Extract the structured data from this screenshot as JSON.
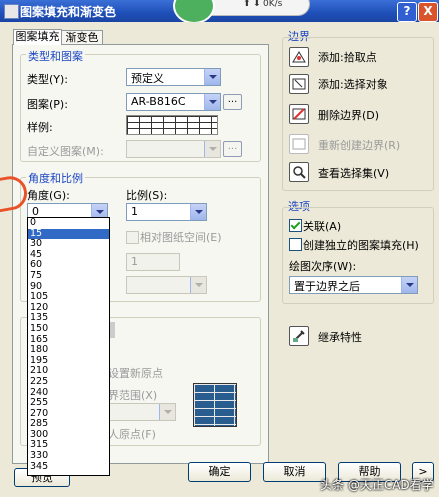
{
  "window": {
    "title": "图案填充和渐变色",
    "help_label": "?",
    "close_label": "X"
  },
  "network": {
    "upload_arrow": "⬆",
    "download_arrow": "⬇",
    "speed": "0K/s"
  },
  "tabs": [
    {
      "label": "图案填充"
    },
    {
      "label": "渐变色"
    }
  ],
  "type_pattern": {
    "title": "类型和图案",
    "type_label": "类型(Y):",
    "type_value": "预定义",
    "pattern_label": "图案(P):",
    "pattern_value": "AR-B816C",
    "pattern_more": "...",
    "sample_label": "样例:",
    "custom_label": "自定义图案(M):",
    "custom_more": "..."
  },
  "angle_scale": {
    "title": "角度和比例",
    "angle_label": "角度(G):",
    "angle_value": "0",
    "scale_label": "比例(S):",
    "scale_value": "1",
    "relative_label": "相对图纸空间(E)",
    "spacing_value": "1",
    "list_options": [
      "0",
      "15",
      "30",
      "45",
      "60",
      "75",
      "90",
      "105",
      "120",
      "135",
      "150",
      "165",
      "180",
      "195",
      "210",
      "225",
      "240",
      "255",
      "270",
      "285",
      "300",
      "315",
      "330",
      "345"
    ],
    "list_selected_index": 1
  },
  "origin": {
    "set_origin_label": "设置新原点",
    "range_label": "界范围(X)",
    "default_origin_label": "人原点(F)"
  },
  "boundary": {
    "title": "边界",
    "add_pick": "添加:拾取点",
    "add_select": "添加:选择对象",
    "remove": "删除边界(D)",
    "recreate": "重新创建边界(R)",
    "view_select": "查看选择集(V)"
  },
  "options": {
    "title": "选项",
    "associative": "关联(A)",
    "independent": "创建独立的图案填充(H)",
    "draw_order_label": "绘图次序(W):",
    "draw_order_value": "置于边界之后"
  },
  "inherit": {
    "label": "继承特性"
  },
  "footer": {
    "preview": "预览",
    "ok": "确定",
    "cancel": "取消",
    "help": "帮助",
    "more": ">"
  },
  "watermark": "头条 @天正CAD看学"
}
